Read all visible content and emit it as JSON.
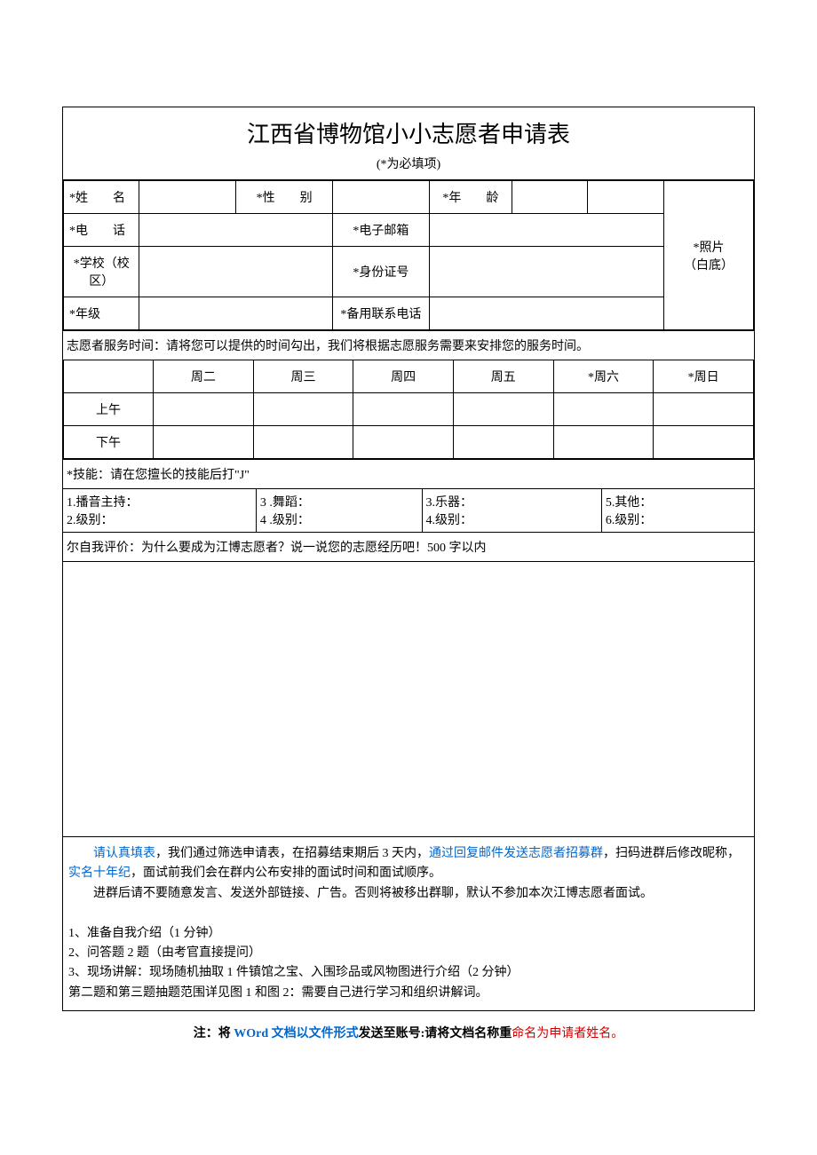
{
  "title": "江西省博物馆小小志愿者申请表",
  "subtitle": "(*为必填项)",
  "labels": {
    "name": "*姓　　名",
    "gender": "*性　　别",
    "age": "*年　　龄",
    "phone": "*电　　话",
    "email": "*电子邮箱",
    "photo": "*照片",
    "photo2": "（白底）",
    "school": "*学校（校区）",
    "idcard": "*身份证号",
    "grade": "*年级",
    "altphone": "*备用联系电话"
  },
  "service_time_header": "志愿者服务时间：请将您可以提供的时间勾出，我们将根据志愿服务需要来安排您的服务时间。",
  "days": {
    "tue": "周二",
    "wed": "周三",
    "thu": "周四",
    "fri": "周五",
    "sat": "*周六",
    "sun": "*周日"
  },
  "periods": {
    "am": "上午",
    "pm": "下午"
  },
  "skills_header": "*技能：请在您擅长的技能后打\"J\"",
  "skills": {
    "c1a": "1.播音主持：",
    "c1b": "2.级别：",
    "c2a": "3 .舞蹈：",
    "c2b": "4 .级别：",
    "c3a": "3.乐器：",
    "c3b": "4.级别：",
    "c4a": "5.其他：",
    "c4b": "6.级别："
  },
  "self_eval": "尔自我评价：为什么要成为江博志愿者？说一说您的志愿经历吧！500 字以内",
  "notice": {
    "p1a": "　　",
    "p1b": "请认真填表",
    "p1c": "，我们通过筛选申请表，在招募结束期后 3 天内，",
    "p1d": "通过回复邮件发送志愿者招募群",
    "p1e": "，扫码进群后修改昵称，",
    "p1f": "实名十年纪",
    "p1g": "，面试前我们会在群内公布安排的面试时间和面试顺序。",
    "p2": "　　进群后请不要随意发言、发送外部链接、广告。否则将被移出群聊，默认不参加本次江博志愿者面试。",
    "l1": "1、准备自我介绍（1 分钟）",
    "l2": "2、问答题 2 题（由考官直接提问）",
    "l3": "3、现场讲解：现场随机抽取 1 件镇馆之宝、入围珍品或风物图进行介绍（2 分钟）",
    "l4": "第二题和第三题抽题范围详见图 1 和图 2：需要自己进行学习和组织讲解词。"
  },
  "footer": {
    "a": "注：将 ",
    "b": "WOrd 文档以文件形式",
    "c": "发送至账号:请将文档名称重",
    "d": "命名为申请者姓名。"
  }
}
